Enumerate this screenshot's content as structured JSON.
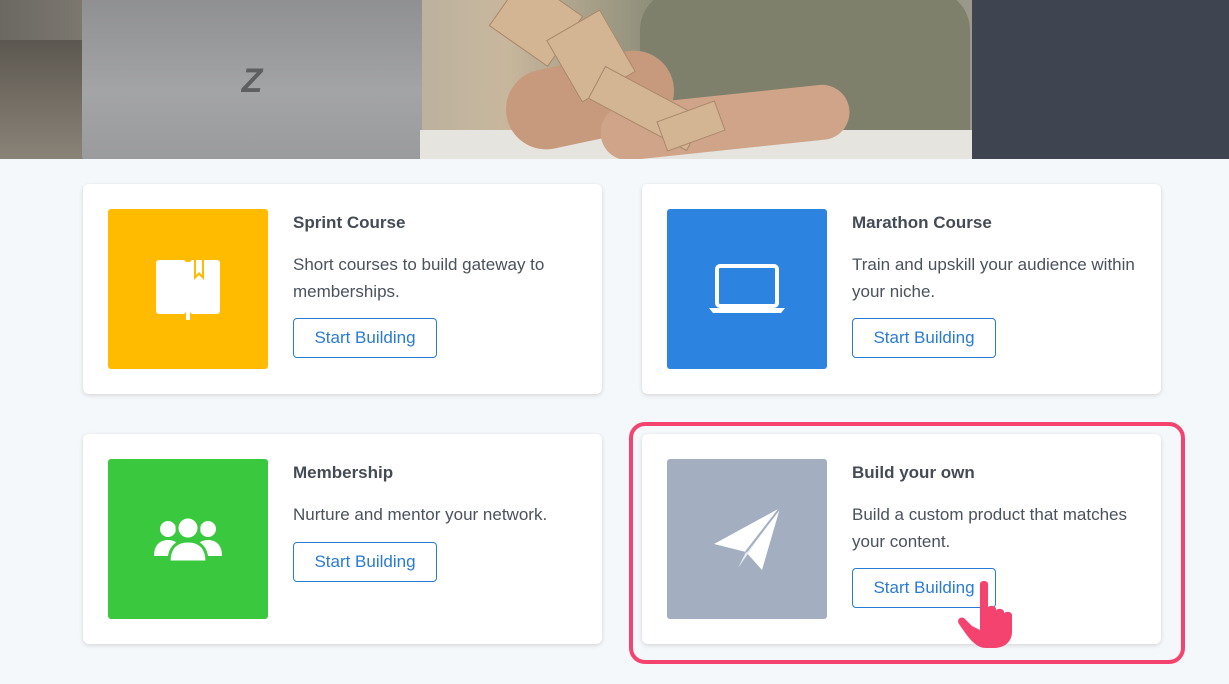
{
  "hero": {
    "laptop_logo": "Z"
  },
  "cards": [
    {
      "title": "Sprint Course",
      "description": "Short courses to build gateway to memberships.",
      "button_label": "Start Building",
      "icon": "book-icon",
      "tile_color": "#ffbb00"
    },
    {
      "title": "Marathon Course",
      "description": "Train and upskill your audience within your niche.",
      "button_label": "Start Building",
      "icon": "laptop-icon",
      "tile_color": "#2c84e0"
    },
    {
      "title": "Membership",
      "description": "Nurture and mentor your network.",
      "button_label": "Start Building",
      "icon": "users-icon",
      "tile_color": "#3ac93e"
    },
    {
      "title": "Build your own",
      "description": "Build a custom product that matches your content.",
      "button_label": "Start Building",
      "icon": "paper-plane-icon",
      "tile_color": "#a3afc1"
    }
  ],
  "colors": {
    "accent": "#2a7bd4",
    "highlight": "#f4436f",
    "background": "#f5f8fb"
  }
}
